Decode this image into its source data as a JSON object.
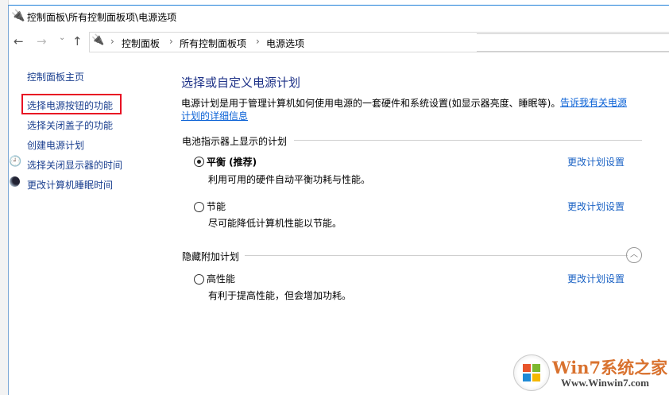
{
  "window": {
    "title": "控制面板\\所有控制面板项\\电源选项"
  },
  "nav": {
    "back": "←",
    "forward": "→",
    "recent": "⌄",
    "up": "↑"
  },
  "breadcrumb": [
    "控制面板",
    "所有控制面板项",
    "电源选项"
  ],
  "breadcrumb_sep": "›",
  "sidebar": {
    "home": "控制面板主页",
    "items": [
      "选择电源按钮的功能",
      "选择关闭盖子的功能",
      "创建电源计划",
      "选择关闭显示器的时间",
      "更改计算机睡眠时间"
    ],
    "highlight_color": "#e81123"
  },
  "main": {
    "heading": "选择或自定义电源计划",
    "description": "电源计划是用于管理计算机如何使用电源的一套硬件和系统设置(如显示器亮度、睡眠等)。",
    "learn_more": "告诉我有关电源计划的详细信息",
    "section_battery": "电池指示器上显示的计划",
    "section_hidden": "隐藏附加计划",
    "plans": [
      {
        "name": "平衡 (推荐)",
        "desc": "利用可用的硬件自动平衡功耗与性能。",
        "selected": true,
        "link": "更改计划设置"
      },
      {
        "name": "节能",
        "desc": "尽可能降低计算机性能以节能。",
        "selected": false,
        "link": "更改计划设置"
      },
      {
        "name": "高性能",
        "desc": "有利于提高性能，但会增加功耗。",
        "selected": false,
        "link": "更改计划设置"
      }
    ]
  },
  "watermark": {
    "brand": "Win7系统之家",
    "url": "Www.Winwin7.com"
  }
}
